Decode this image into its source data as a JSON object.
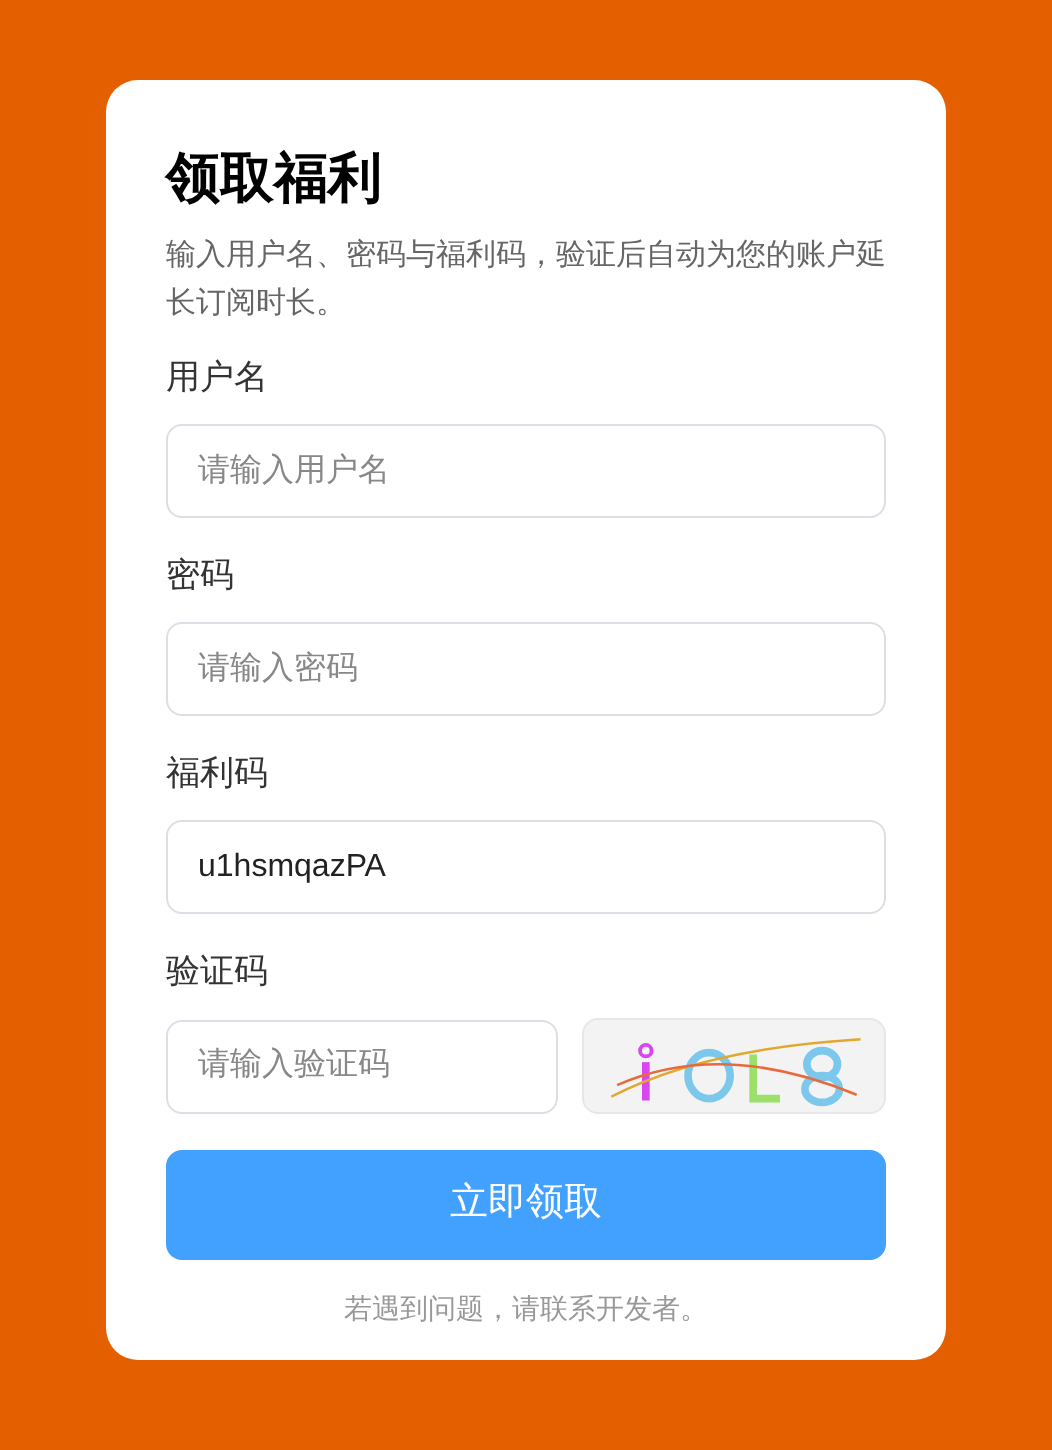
{
  "card": {
    "title": "领取福利",
    "description": "输入用户名、密码与福利码，验证后自动为您的账户延长订阅时长。",
    "fields": [
      {
        "kind": "text",
        "label": "用户名",
        "placeholder": "请输入用户名"
      },
      {
        "kind": "text",
        "label": "密码",
        "placeholder": "请输入密码"
      },
      {
        "kind": "text",
        "label": "福利码",
        "value": "u1hsmqazPA"
      },
      {
        "kind": "captcha",
        "label": "验证码",
        "placeholder": "请输入验证码"
      }
    ],
    "submit": "立即领取",
    "footer": "若遇到问题，请联系开发者。"
  }
}
